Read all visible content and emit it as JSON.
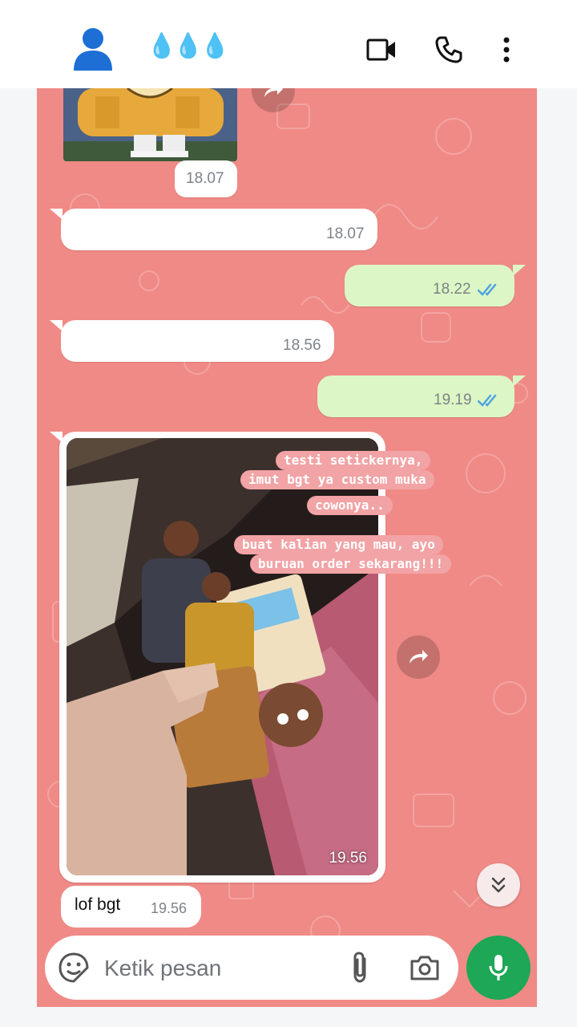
{
  "header": {
    "contact_name": "💧💧💧",
    "icons": [
      "avatar-icon",
      "video-call-icon",
      "voice-call-icon",
      "more-options-icon"
    ]
  },
  "messages": [
    {
      "direction": "in",
      "kind": "image-partial",
      "time": "18.07"
    },
    {
      "direction": "in",
      "kind": "text",
      "text": "",
      "time": "18.07"
    },
    {
      "direction": "out",
      "kind": "text",
      "text": "",
      "time": "18.22",
      "status": "read"
    },
    {
      "direction": "in",
      "kind": "text",
      "text": "",
      "time": "18.56"
    },
    {
      "direction": "out",
      "kind": "text",
      "text": "",
      "time": "19.19",
      "status": "read"
    },
    {
      "direction": "in",
      "kind": "image",
      "time": "19.56",
      "overlay_text": [
        "testi setickernya,",
        "imut bgt ya custom muka",
        "cowonya..",
        "buat kalian yang mau, ayo",
        "buruan order sekarang!!!"
      ]
    },
    {
      "direction": "in",
      "kind": "text",
      "text": "lof bgt",
      "time": "19.56"
    }
  ],
  "composer": {
    "placeholder": "Ketik pesan"
  },
  "colors": {
    "chat_bg": "#f08a86",
    "incoming": "#ffffff",
    "outgoing": "#dcf7c5",
    "read_ticks": "#4fa3e0",
    "mic_button": "#1da756"
  }
}
